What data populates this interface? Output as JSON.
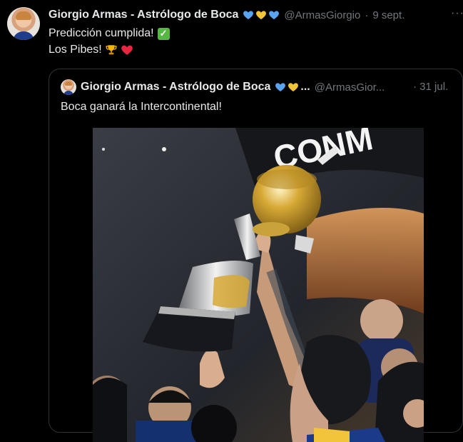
{
  "tweet": {
    "author_name": "Giorgio Armas - Astrólogo de Boca",
    "handle": "@ArmasGiorgio",
    "separator": "·",
    "date": "9 sept.",
    "more_label": "···",
    "line1": "Predicción cumplida!",
    "line2": "Los Pibes!",
    "check_glyph": "✓"
  },
  "quoted_tweet": {
    "author_name": "Giorgio Armas - Astrólogo de Boca",
    "name_ellipsis": "...",
    "handle": "@ArmasGior...",
    "separator": "·",
    "date": "31 jul.",
    "text": "Boca ganará la Intercontinental!",
    "photo_banner_text": "CONM"
  },
  "colors": {
    "background": "#000000",
    "text_primary": "#e7e9ea",
    "text_secondary": "#71767b",
    "border": "#2f3336",
    "heart_blue": "#5aa3f0",
    "heart_yellow": "#f2c43a",
    "heart_red": "#e8263f",
    "check_green": "#56b842"
  },
  "icons": {
    "avatar": "profile-photo",
    "heart_blue": "blue-heart-icon",
    "heart_yellow": "yellow-heart-icon",
    "heart_red": "red-heart-icon",
    "trophy": "trophy-icon",
    "check": "check-mark-button-icon",
    "more": "more-options-icon"
  }
}
